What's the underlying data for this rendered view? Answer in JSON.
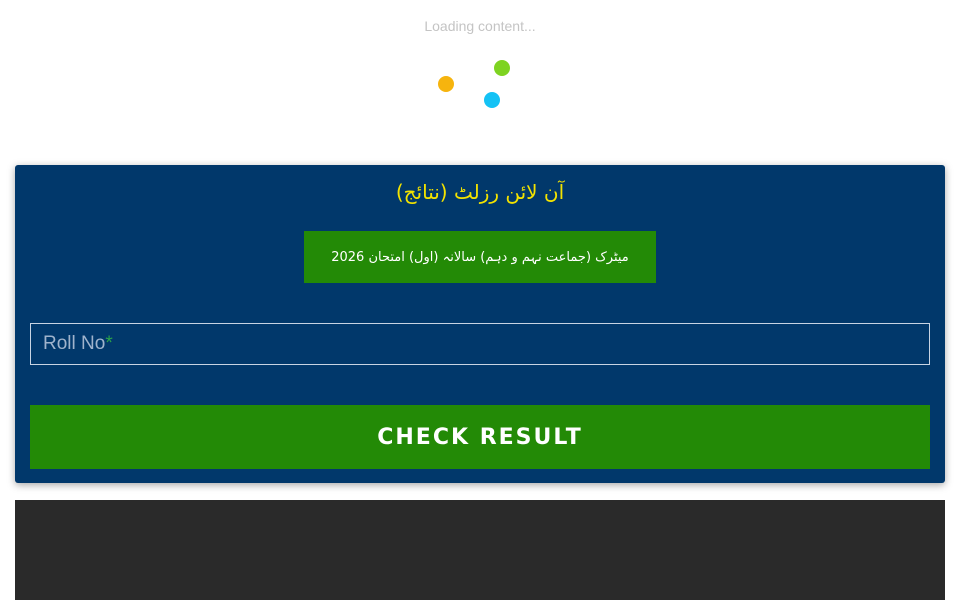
{
  "loader": {
    "text": "Loading content...",
    "dots": [
      "yellow-dot",
      "green-dot",
      "blue-dot"
    ]
  },
  "colors": {
    "dot_yellow": "#f6b40e",
    "dot_green": "#7ed321",
    "dot_blue": "#14c2f5",
    "card_bg": "#01386b",
    "title": "#f3e300",
    "badge_bg": "#238a06",
    "button_bg": "#238a06",
    "dark_panel": "#2a2a2a"
  },
  "card": {
    "title": "آن لائن رزلٹ (نتائج)",
    "exam_label": "میٹرک (جماعت نہم و دہم) سالانہ (اول) امتحان 2026"
  },
  "form": {
    "roll_label": "Roll No",
    "required_mark": "*",
    "submit_label": "CHECK RESULT"
  }
}
